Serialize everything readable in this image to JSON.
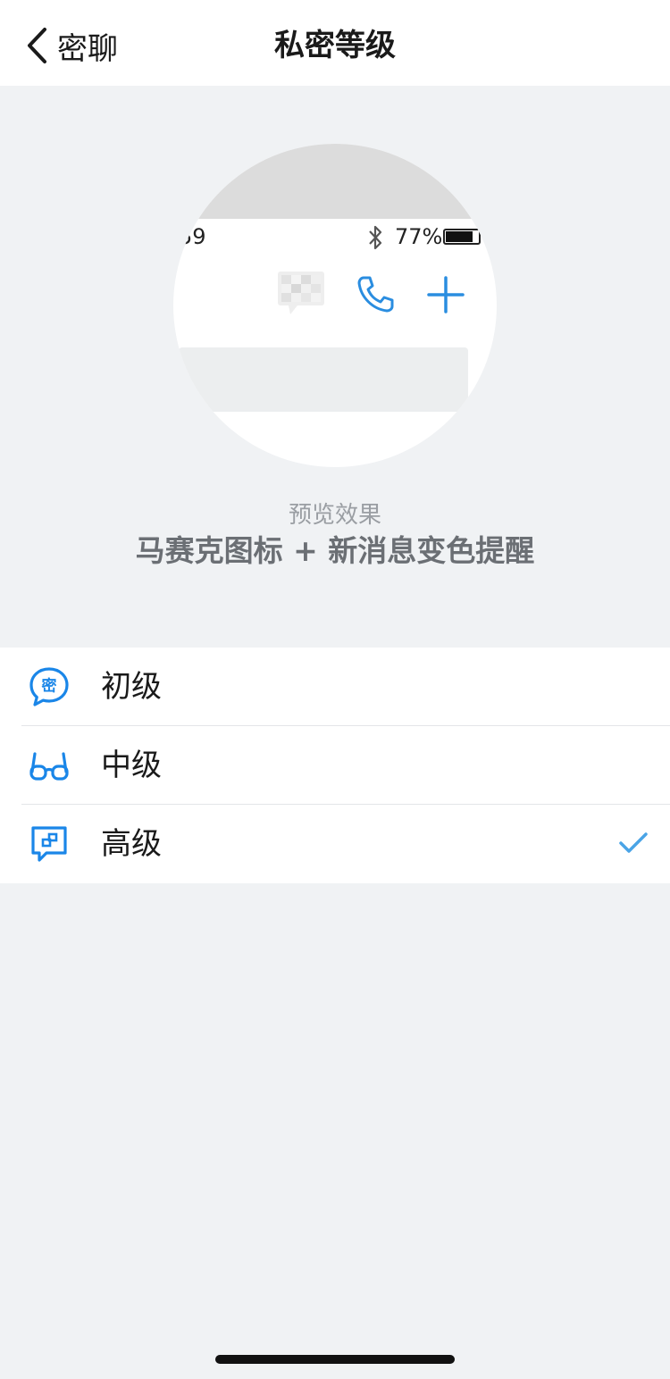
{
  "navbar": {
    "back_label": "密聊",
    "title": "私密等级"
  },
  "preview": {
    "status_time_fragment": "59",
    "battery_percent": "77%",
    "caption": "预览效果",
    "description": "马赛克图标 + 新消息变色提醒"
  },
  "levels": [
    {
      "label": "初级",
      "icon": "secret-bubble-icon",
      "selected": false
    },
    {
      "label": "中级",
      "icon": "glasses-icon",
      "selected": false
    },
    {
      "label": "高级",
      "icon": "mosaic-chat-icon",
      "selected": true
    }
  ],
  "colors": {
    "accent": "#1a86e8",
    "check": "#4aa4e6",
    "background": "#f0f2f4"
  }
}
